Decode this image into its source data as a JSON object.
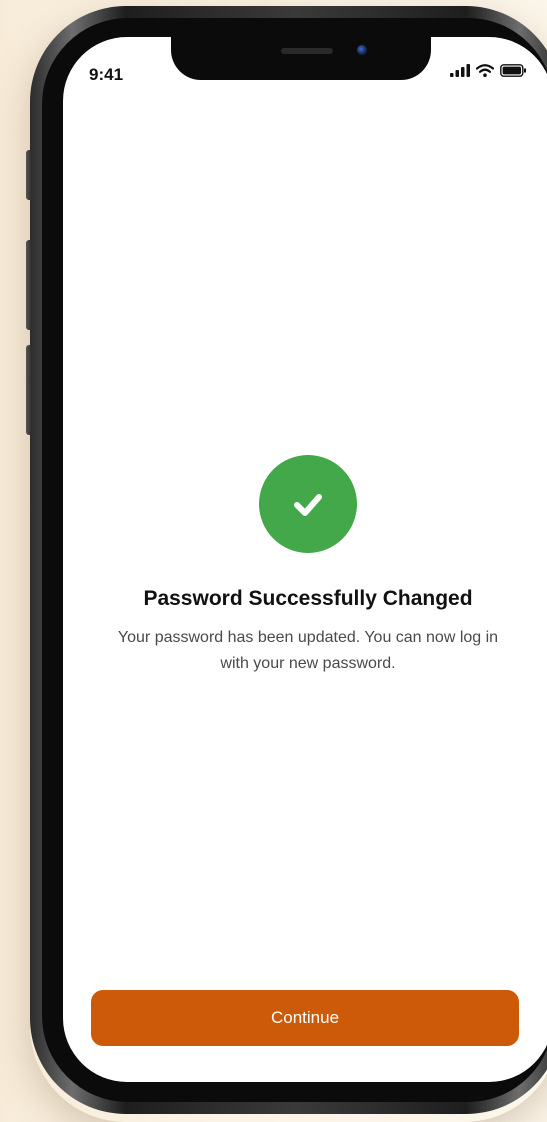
{
  "status_bar": {
    "time": "9:41"
  },
  "icons": {
    "signal": "cellular-signal-icon",
    "wifi": "wifi-icon",
    "battery": "battery-icon",
    "success": "checkmark-icon"
  },
  "colors": {
    "success_green": "#43a84a",
    "primary_button": "#cc5a08"
  },
  "success": {
    "title": "Password Successfully Changed",
    "message": "Your password has been updated. You can now log in with your new password."
  },
  "actions": {
    "continue_label": "Continue"
  }
}
